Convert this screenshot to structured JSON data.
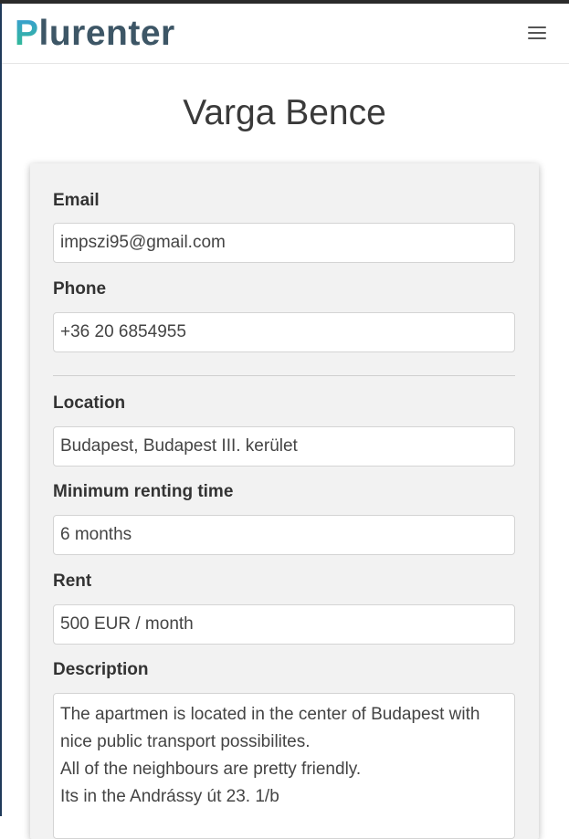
{
  "brand": {
    "first_letter": "P",
    "rest": "lurenter"
  },
  "navbar": {
    "menu_icon": "hamburger-menu-icon"
  },
  "profile": {
    "name": "Varga Bence"
  },
  "form": {
    "email": {
      "label": "Email",
      "value": "impszi95@gmail.com"
    },
    "phone": {
      "label": "Phone",
      "value": "+36 20 6854955"
    },
    "location": {
      "label": "Location",
      "value": "Budapest, Budapest III. kerület"
    },
    "min_renting_time": {
      "label": "Minimum renting time",
      "value": "6 months"
    },
    "rent": {
      "label": "Rent",
      "value": "500 EUR / month"
    },
    "description": {
      "label": "Description",
      "lines": [
        "The apartmen is located in the center of Budapest with",
        "nice public transport possibilites.",
        "All of the neighbours are pretty friendly.",
        "Its in the Andrássy út 23. 1/b"
      ]
    }
  },
  "colors": {
    "logo_dark": "#3d5666",
    "logo_accent": "#2fb989",
    "card_background": "#f2f2f2"
  }
}
